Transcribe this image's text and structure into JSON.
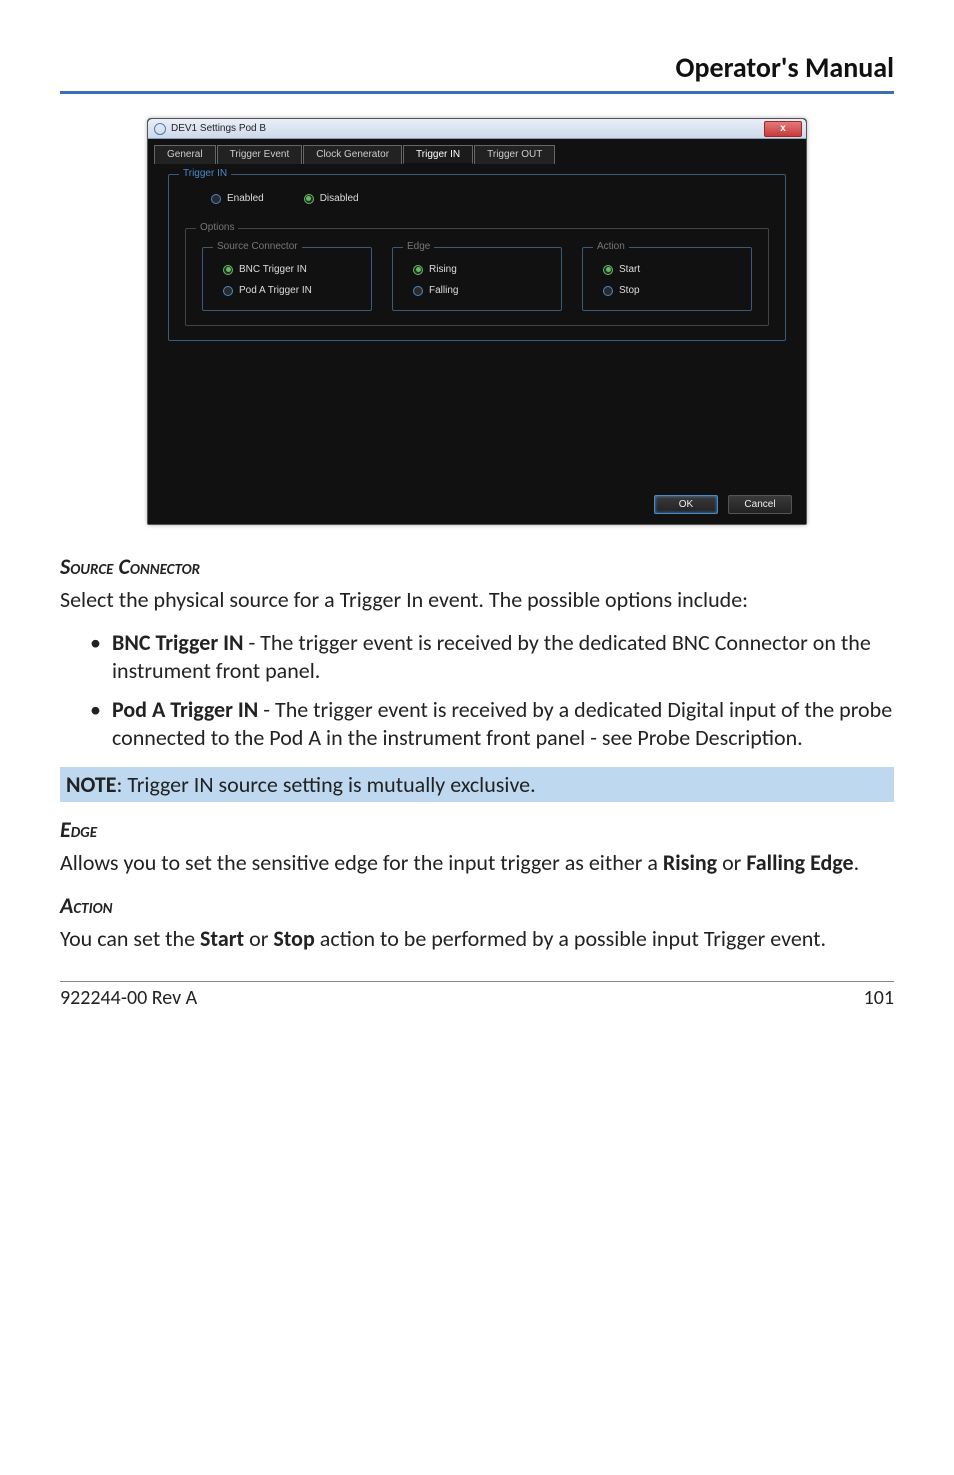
{
  "header": {
    "title": "Operator's Manual"
  },
  "window": {
    "title": "DEV1 Settings Pod B",
    "close_symbol": "x",
    "tabs": {
      "general": "General",
      "trigger_event": "Trigger Event",
      "clock_generator": "Clock Generator",
      "trigger_in": "Trigger IN",
      "trigger_out": "Trigger OUT"
    },
    "trigger_in_group": {
      "legend": "Trigger IN",
      "enabled": "Enabled",
      "disabled": "Disabled"
    },
    "options_group": {
      "legend": "Options",
      "source_connector": {
        "legend": "Source Connector",
        "bnc": "BNC Trigger IN",
        "pod_a": "Pod A Trigger IN"
      },
      "edge": {
        "legend": "Edge",
        "rising": "Rising",
        "falling": "Falling"
      },
      "action": {
        "legend": "Action",
        "start": "Start",
        "stop": "Stop"
      }
    },
    "buttons": {
      "ok": "OK",
      "cancel": "Cancel"
    }
  },
  "sections": {
    "source_connector": {
      "heading": "Source Connector",
      "intro": "Select the physical source for a Trigger In event. The possible options include:",
      "bullet1_label": "BNC Trigger IN",
      "bullet1_text": " - The trigger event is received by the dedicated BNC Connector on the instrument front panel.",
      "bullet2_label": "Pod A Trigger IN",
      "bullet2_text": " - The trigger event is received by a dedicated Digital input of the probe connected to the Pod A in the instrument front panel - see Probe Description."
    },
    "note_prefix": "NOTE",
    "note_text": ": Trigger IN source setting is mutually exclusive.",
    "edge": {
      "heading": "Edge",
      "text_a": "Allows you to set the sensitive edge for the input trigger as either a ",
      "rising": "Rising",
      "or": " or ",
      "falling": "Falling Edge",
      "dot": "."
    },
    "action": {
      "heading": "Action",
      "text_a": "You can set the ",
      "start": "Start",
      "or": " or ",
      "stop": "Stop",
      "text_b": " action to be performed by a possible input Trigger event."
    }
  },
  "footer": {
    "rev": "922244-00 Rev A",
    "page": "101"
  }
}
